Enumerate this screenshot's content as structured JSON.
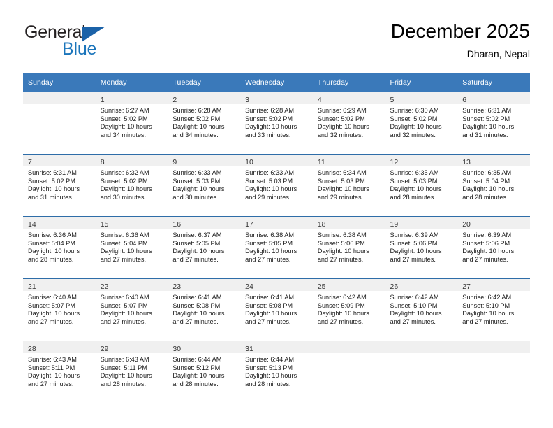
{
  "brand": {
    "name_top": "General",
    "name_bottom": "Blue",
    "triangle_icon": "triangle-logo-icon",
    "accent_color": "#1b75bb"
  },
  "header": {
    "title": "December 2025",
    "location": "Dharan, Nepal"
  },
  "theme": {
    "header_row_color": "#3a79ba",
    "row_divider_color": "#2e6da8",
    "daynum_band_color": "#f0f0f0"
  },
  "weekday_headers": [
    "Sunday",
    "Monday",
    "Tuesday",
    "Wednesday",
    "Thursday",
    "Friday",
    "Saturday"
  ],
  "weeks": [
    [
      {
        "day": "",
        "lines": []
      },
      {
        "day": "1",
        "lines": [
          "Sunrise: 6:27 AM",
          "Sunset: 5:02 PM",
          "Daylight: 10 hours",
          "and 34 minutes."
        ]
      },
      {
        "day": "2",
        "lines": [
          "Sunrise: 6:28 AM",
          "Sunset: 5:02 PM",
          "Daylight: 10 hours",
          "and 34 minutes."
        ]
      },
      {
        "day": "3",
        "lines": [
          "Sunrise: 6:28 AM",
          "Sunset: 5:02 PM",
          "Daylight: 10 hours",
          "and 33 minutes."
        ]
      },
      {
        "day": "4",
        "lines": [
          "Sunrise: 6:29 AM",
          "Sunset: 5:02 PM",
          "Daylight: 10 hours",
          "and 32 minutes."
        ]
      },
      {
        "day": "5",
        "lines": [
          "Sunrise: 6:30 AM",
          "Sunset: 5:02 PM",
          "Daylight: 10 hours",
          "and 32 minutes."
        ]
      },
      {
        "day": "6",
        "lines": [
          "Sunrise: 6:31 AM",
          "Sunset: 5:02 PM",
          "Daylight: 10 hours",
          "and 31 minutes."
        ]
      }
    ],
    [
      {
        "day": "7",
        "lines": [
          "Sunrise: 6:31 AM",
          "Sunset: 5:02 PM",
          "Daylight: 10 hours",
          "and 31 minutes."
        ]
      },
      {
        "day": "8",
        "lines": [
          "Sunrise: 6:32 AM",
          "Sunset: 5:02 PM",
          "Daylight: 10 hours",
          "and 30 minutes."
        ]
      },
      {
        "day": "9",
        "lines": [
          "Sunrise: 6:33 AM",
          "Sunset: 5:03 PM",
          "Daylight: 10 hours",
          "and 30 minutes."
        ]
      },
      {
        "day": "10",
        "lines": [
          "Sunrise: 6:33 AM",
          "Sunset: 5:03 PM",
          "Daylight: 10 hours",
          "and 29 minutes."
        ]
      },
      {
        "day": "11",
        "lines": [
          "Sunrise: 6:34 AM",
          "Sunset: 5:03 PM",
          "Daylight: 10 hours",
          "and 29 minutes."
        ]
      },
      {
        "day": "12",
        "lines": [
          "Sunrise: 6:35 AM",
          "Sunset: 5:03 PM",
          "Daylight: 10 hours",
          "and 28 minutes."
        ]
      },
      {
        "day": "13",
        "lines": [
          "Sunrise: 6:35 AM",
          "Sunset: 5:04 PM",
          "Daylight: 10 hours",
          "and 28 minutes."
        ]
      }
    ],
    [
      {
        "day": "14",
        "lines": [
          "Sunrise: 6:36 AM",
          "Sunset: 5:04 PM",
          "Daylight: 10 hours",
          "and 28 minutes."
        ]
      },
      {
        "day": "15",
        "lines": [
          "Sunrise: 6:36 AM",
          "Sunset: 5:04 PM",
          "Daylight: 10 hours",
          "and 27 minutes."
        ]
      },
      {
        "day": "16",
        "lines": [
          "Sunrise: 6:37 AM",
          "Sunset: 5:05 PM",
          "Daylight: 10 hours",
          "and 27 minutes."
        ]
      },
      {
        "day": "17",
        "lines": [
          "Sunrise: 6:38 AM",
          "Sunset: 5:05 PM",
          "Daylight: 10 hours",
          "and 27 minutes."
        ]
      },
      {
        "day": "18",
        "lines": [
          "Sunrise: 6:38 AM",
          "Sunset: 5:06 PM",
          "Daylight: 10 hours",
          "and 27 minutes."
        ]
      },
      {
        "day": "19",
        "lines": [
          "Sunrise: 6:39 AM",
          "Sunset: 5:06 PM",
          "Daylight: 10 hours",
          "and 27 minutes."
        ]
      },
      {
        "day": "20",
        "lines": [
          "Sunrise: 6:39 AM",
          "Sunset: 5:06 PM",
          "Daylight: 10 hours",
          "and 27 minutes."
        ]
      }
    ],
    [
      {
        "day": "21",
        "lines": [
          "Sunrise: 6:40 AM",
          "Sunset: 5:07 PM",
          "Daylight: 10 hours",
          "and 27 minutes."
        ]
      },
      {
        "day": "22",
        "lines": [
          "Sunrise: 6:40 AM",
          "Sunset: 5:07 PM",
          "Daylight: 10 hours",
          "and 27 minutes."
        ]
      },
      {
        "day": "23",
        "lines": [
          "Sunrise: 6:41 AM",
          "Sunset: 5:08 PM",
          "Daylight: 10 hours",
          "and 27 minutes."
        ]
      },
      {
        "day": "24",
        "lines": [
          "Sunrise: 6:41 AM",
          "Sunset: 5:08 PM",
          "Daylight: 10 hours",
          "and 27 minutes."
        ]
      },
      {
        "day": "25",
        "lines": [
          "Sunrise: 6:42 AM",
          "Sunset: 5:09 PM",
          "Daylight: 10 hours",
          "and 27 minutes."
        ]
      },
      {
        "day": "26",
        "lines": [
          "Sunrise: 6:42 AM",
          "Sunset: 5:10 PM",
          "Daylight: 10 hours",
          "and 27 minutes."
        ]
      },
      {
        "day": "27",
        "lines": [
          "Sunrise: 6:42 AM",
          "Sunset: 5:10 PM",
          "Daylight: 10 hours",
          "and 27 minutes."
        ]
      }
    ],
    [
      {
        "day": "28",
        "lines": [
          "Sunrise: 6:43 AM",
          "Sunset: 5:11 PM",
          "Daylight: 10 hours",
          "and 27 minutes."
        ]
      },
      {
        "day": "29",
        "lines": [
          "Sunrise: 6:43 AM",
          "Sunset: 5:11 PM",
          "Daylight: 10 hours",
          "and 28 minutes."
        ]
      },
      {
        "day": "30",
        "lines": [
          "Sunrise: 6:44 AM",
          "Sunset: 5:12 PM",
          "Daylight: 10 hours",
          "and 28 minutes."
        ]
      },
      {
        "day": "31",
        "lines": [
          "Sunrise: 6:44 AM",
          "Sunset: 5:13 PM",
          "Daylight: 10 hours",
          "and 28 minutes."
        ]
      },
      {
        "day": "",
        "lines": []
      },
      {
        "day": "",
        "lines": []
      },
      {
        "day": "",
        "lines": []
      }
    ]
  ]
}
